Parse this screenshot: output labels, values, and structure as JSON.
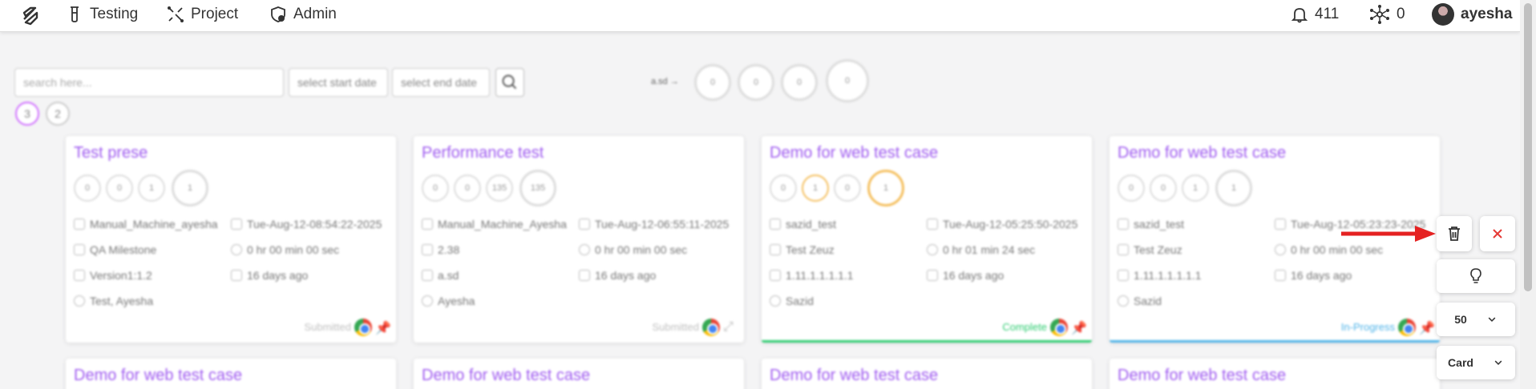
{
  "nav": {
    "testing": "Testing",
    "project": "Project",
    "admin": "Admin",
    "notifications_count": "411",
    "network_count": "0",
    "username": "ayesha"
  },
  "filters": {
    "search_placeholder": "search here...",
    "start_date_placeholder": "select start date",
    "end_date_placeholder": "select end date",
    "label": "a.sd →",
    "rings": [
      "0",
      "0",
      "0",
      "0"
    ],
    "pages": [
      "3",
      "2"
    ]
  },
  "cards": [
    {
      "title": "Test prese",
      "stats": [
        "0",
        "0",
        "1",
        "1"
      ],
      "owner": "Manual_Machine_ayesha",
      "date": "Tue-Aug-12-08:54:22-2025",
      "milestone": "QA Milestone",
      "duration": "0 hr 00 min 00 sec",
      "version": "Version1:1.2",
      "ago": "16 days ago",
      "assignee": "Test, Ayesha",
      "status": "Submitted",
      "status_color": "#c0c0c0"
    },
    {
      "title": "Performance test",
      "stats": [
        "0",
        "0",
        "135",
        "135"
      ],
      "owner": "Manual_Machine_Ayesha",
      "date": "Tue-Aug-12-06:55:11-2025",
      "milestone": "2.38",
      "duration": "0 hr 00 min 00 sec",
      "version": "a.sd",
      "ago": "16 days ago",
      "assignee": "Ayesha",
      "status": "Submitted",
      "status_color": "#c0c0c0"
    },
    {
      "title": "Demo for web test case",
      "stats": [
        "0",
        "1",
        "0",
        "1"
      ],
      "owner": "sazid_test",
      "date": "Tue-Aug-12-05:25:50-2025",
      "milestone": "Test Zeuz",
      "duration": "0 hr 01 min 24 sec",
      "version": "1.11.1.1.1.1.1",
      "ago": "16 days ago",
      "assignee": "Sazid",
      "status": "Complete",
      "status_color": "#2ecc71"
    },
    {
      "title": "Demo for web test case",
      "stats": [
        "0",
        "0",
        "1",
        "1"
      ],
      "owner": "sazid_test",
      "date": "Tue-Aug-12-05:23:23-2025",
      "milestone": "Test Zeuz",
      "duration": "0 hr 00 min 00 sec",
      "version": "1.11.1.1.1.1.1",
      "ago": "16 days ago",
      "assignee": "Sazid",
      "status": "In-Progress",
      "status_color": "#4fb3e8"
    }
  ],
  "next_cards": [
    "Demo for web test case",
    "Demo for web test case",
    "Demo for web test case",
    "Demo for web test case"
  ],
  "sidebar": {
    "page_size": "50",
    "view_mode": "Card"
  },
  "colors": {
    "accent": "#a05cf0",
    "delete_icon": "#333333",
    "close_icon": "#e53935",
    "arrow": "#e52222"
  }
}
